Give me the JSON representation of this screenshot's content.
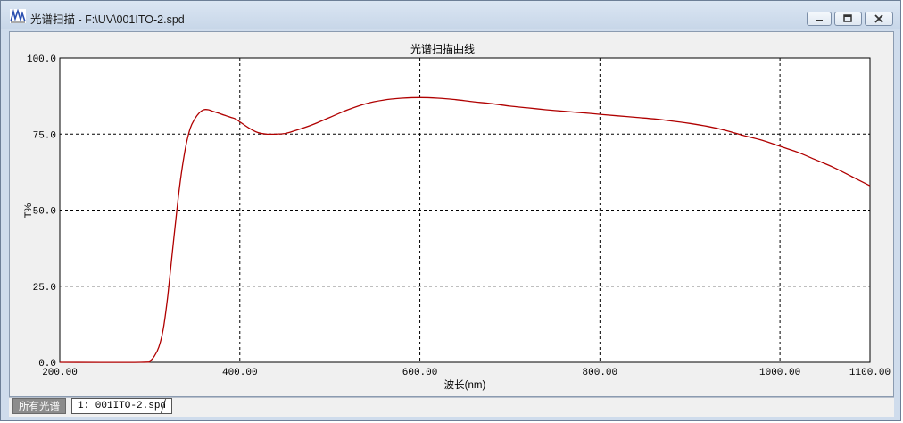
{
  "window": {
    "title": "光谱扫描 - F:\\UV\\001ITO-2.spd",
    "app_icon": "spectrum-app-icon",
    "buttons": [
      "minimize-icon",
      "restore-icon",
      "close-icon"
    ]
  },
  "tabs": {
    "all_label": "所有光谱",
    "file_label": "1: 001ITO-2.spd"
  },
  "chart_data": {
    "type": "line",
    "title": "光谱扫描曲线",
    "xlabel": "波长(nm)",
    "ylabel": "T%",
    "xlim": [
      200,
      1100
    ],
    "ylim": [
      0,
      100
    ],
    "x_ticks": [
      "200.00",
      "400.00",
      "600.00",
      "800.00",
      "1000.00",
      "1100.00"
    ],
    "x_tick_values": [
      200,
      400,
      600,
      800,
      1000,
      1100
    ],
    "y_ticks": [
      "0.0",
      "25.0",
      "50.0",
      "75.0",
      "100.0"
    ],
    "y_tick_values": [
      0,
      25,
      50,
      75,
      100
    ],
    "grid": true,
    "series": [
      {
        "color": "#b00000",
        "x": [
          200,
          290,
          300,
          305,
          310,
          315,
          320,
          325,
          330,
          335,
          340,
          345,
          350,
          355,
          360,
          365,
          370,
          375,
          380,
          385,
          390,
          395,
          400,
          410,
          420,
          430,
          440,
          450,
          460,
          480,
          500,
          520,
          540,
          560,
          580,
          600,
          620,
          640,
          660,
          680,
          700,
          720,
          740,
          760,
          780,
          800,
          820,
          840,
          860,
          880,
          900,
          920,
          940,
          960,
          980,
          1000,
          1020,
          1040,
          1060,
          1080,
          1100
        ],
        "y": [
          0,
          0,
          0.5,
          2,
          5,
          11,
          22,
          36,
          50,
          62,
          71,
          77,
          80,
          82,
          83,
          83,
          82.5,
          82,
          81.5,
          81,
          80.5,
          80,
          79,
          77,
          75.5,
          75,
          75,
          75.2,
          76,
          78,
          80.5,
          83,
          85,
          86.2,
          86.8,
          87,
          86.8,
          86.3,
          85.6,
          85,
          84.2,
          83.6,
          83,
          82.5,
          82,
          81.5,
          81,
          80.5,
          80,
          79.3,
          78.5,
          77.5,
          76.2,
          74.5,
          73,
          71,
          69,
          66.5,
          64,
          61,
          58
        ]
      }
    ]
  }
}
